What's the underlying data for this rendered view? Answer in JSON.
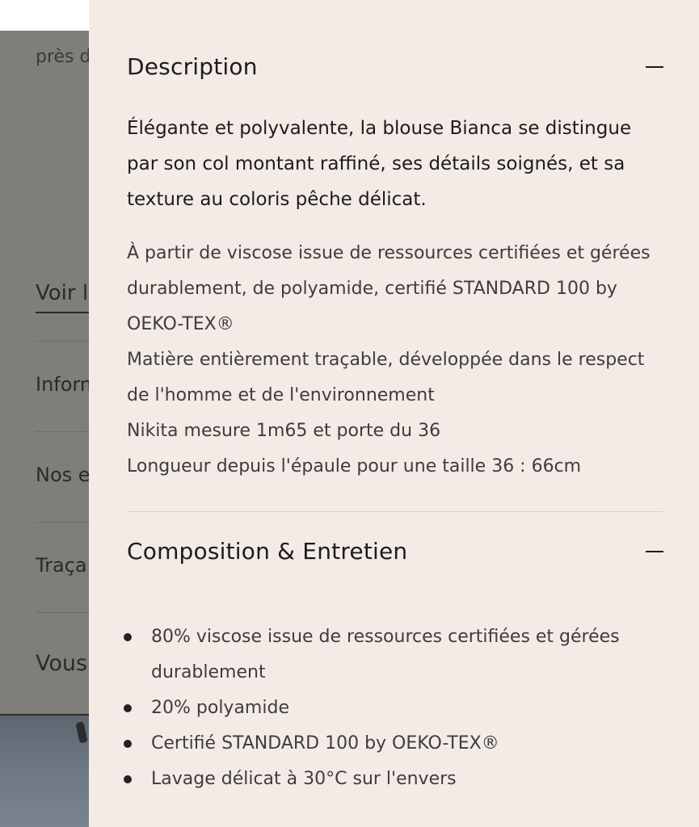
{
  "background_page": {
    "partial_text": "près d",
    "link_partial": "Voir l",
    "menu_items": [
      "Inform",
      "Nos e",
      "Traça",
      "Vous"
    ]
  },
  "drawer": {
    "description": {
      "title": "Description",
      "lead": "Élégante et polyvalente, la blouse Bianca se distingue par son col montant raffiné, ses détails soignés, et sa texture au coloris pêche délicat.",
      "paragraphs": [
        "À partir de viscose issue de ressources certifiées et gérées durablement, de polyamide, certifié STANDARD 100 by OEKO-TEX®",
        "Matière entièrement traçable, développée dans le respect de l'homme et de l'environnement",
        "Nikita mesure 1m65 et porte du 36",
        "Longueur depuis l'épaule pour une taille 36 : 66cm"
      ]
    },
    "composition": {
      "title": "Composition & Entretien",
      "items": [
        "80% viscose issue de ressources certifiées et gérées durablement",
        "20% polyamide",
        "Certifié STANDARD 100 by OEKO-TEX®",
        "Lavage délicat à 30°C sur l'envers"
      ]
    },
    "icons": {
      "collapse": "minus-icon"
    }
  },
  "colors": {
    "drawer_background": "#f4ebe6",
    "overlay": "#7f7e7a",
    "text": "#1c1c1c"
  }
}
